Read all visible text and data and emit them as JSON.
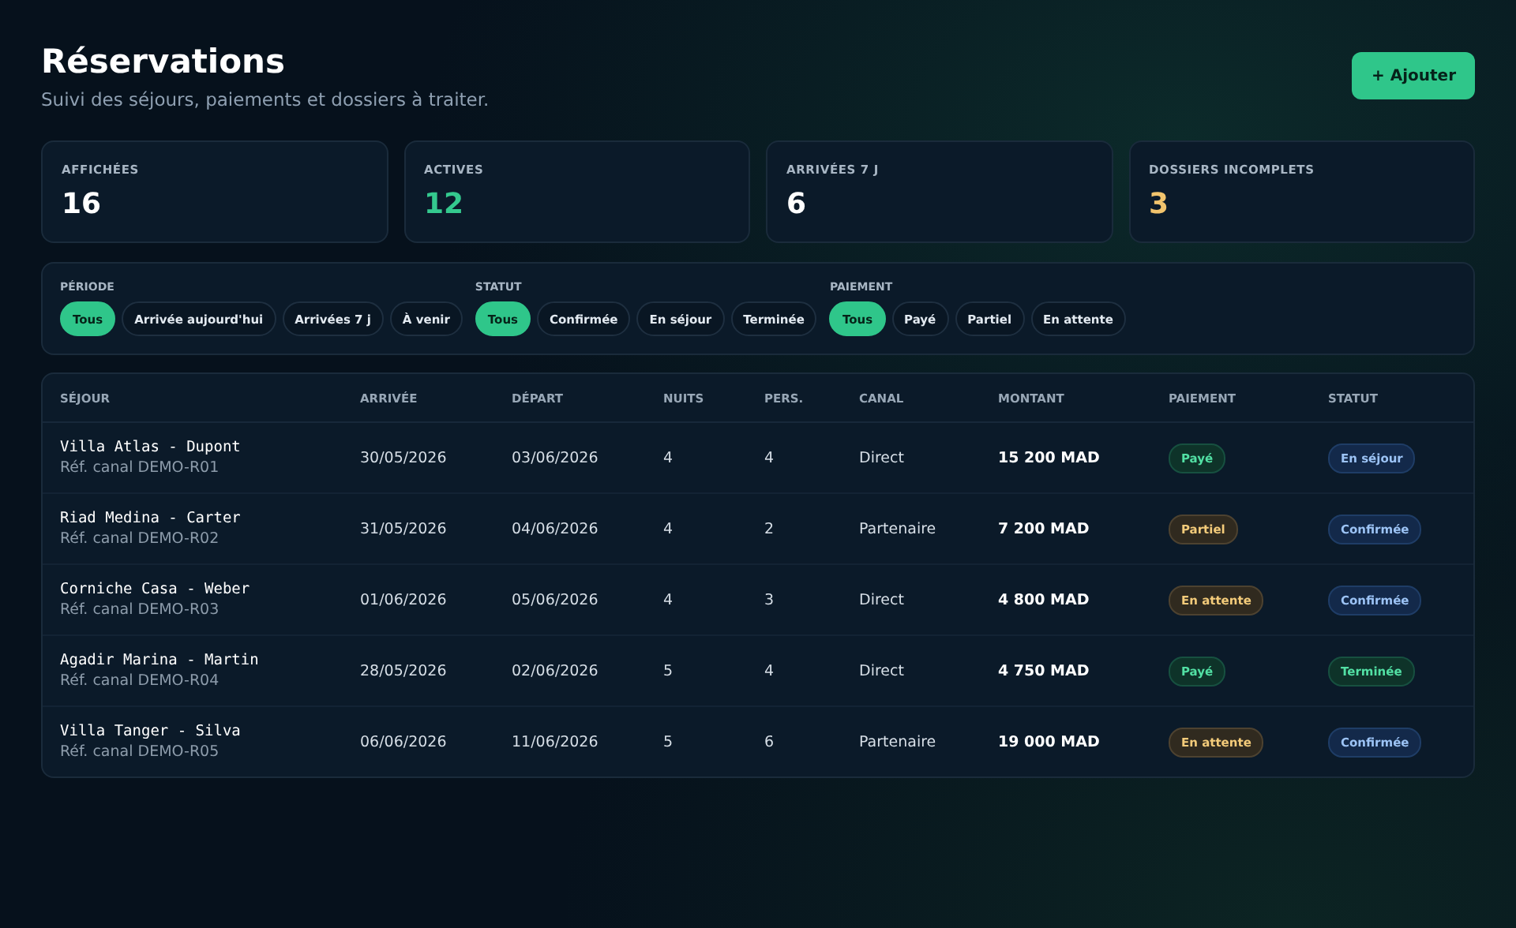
{
  "header": {
    "title": "Réservations",
    "subtitle": "Suivi des séjours, paiements et dossiers à traiter.",
    "add_button": "+ Ajouter"
  },
  "stats": [
    {
      "label": "AFFICHÉES",
      "value": "16",
      "color": "#ffffff"
    },
    {
      "label": "ACTIVES",
      "value": "12",
      "color": "#34c98e"
    },
    {
      "label": "ARRIVÉES 7 J",
      "value": "6",
      "color": "#ffffff"
    },
    {
      "label": "DOSSIERS INCOMPLETS",
      "value": "3",
      "color": "#f2c46d"
    }
  ],
  "filters": [
    {
      "label": "PÉRIODE",
      "options": [
        {
          "label": "Tous",
          "selected": true
        },
        {
          "label": "Arrivée aujourd'hui",
          "selected": false
        },
        {
          "label": "Arrivées 7 j",
          "selected": false
        },
        {
          "label": "À venir",
          "selected": false
        }
      ]
    },
    {
      "label": "STATUT",
      "options": [
        {
          "label": "Tous",
          "selected": true
        },
        {
          "label": "Confirmée",
          "selected": false
        },
        {
          "label": "En séjour",
          "selected": false
        },
        {
          "label": "Terminée",
          "selected": false
        }
      ]
    },
    {
      "label": "PAIEMENT",
      "options": [
        {
          "label": "Tous",
          "selected": true
        },
        {
          "label": "Payé",
          "selected": false
        },
        {
          "label": "Partiel",
          "selected": false
        },
        {
          "label": "En attente",
          "selected": false
        }
      ]
    }
  ],
  "table": {
    "columns": [
      "SÉJOUR",
      "ARRIVÉE",
      "DÉPART",
      "NUITS",
      "PERS.",
      "CANAL",
      "MONTANT",
      "PAIEMENT",
      "STATUT"
    ],
    "rows": [
      {
        "name": "Villa Atlas - Dupont",
        "ref": "Réf. canal DEMO-R01",
        "arrival": "30/05/2026",
        "departure": "03/06/2026",
        "nights": "4",
        "persons": "4",
        "channel": "Direct",
        "amount": "15 200 MAD",
        "payment": {
          "label": "Payé",
          "kind": "success"
        },
        "status": {
          "label": "En séjour",
          "kind": "info"
        }
      },
      {
        "name": "Riad Medina - Carter",
        "ref": "Réf. canal DEMO-R02",
        "arrival": "31/05/2026",
        "departure": "04/06/2026",
        "nights": "4",
        "persons": "2",
        "channel": "Partenaire",
        "amount": "7 200 MAD",
        "payment": {
          "label": "Partiel",
          "kind": "warning"
        },
        "status": {
          "label": "Confirmée",
          "kind": "info"
        }
      },
      {
        "name": "Corniche Casa - Weber",
        "ref": "Réf. canal DEMO-R03",
        "arrival": "01/06/2026",
        "departure": "05/06/2026",
        "nights": "4",
        "persons": "3",
        "channel": "Direct",
        "amount": "4 800 MAD",
        "payment": {
          "label": "En attente",
          "kind": "warning"
        },
        "status": {
          "label": "Confirmée",
          "kind": "info"
        }
      },
      {
        "name": "Agadir Marina - Martin",
        "ref": "Réf. canal DEMO-R04",
        "arrival": "28/05/2026",
        "departure": "02/06/2026",
        "nights": "5",
        "persons": "4",
        "channel": "Direct",
        "amount": "4 750 MAD",
        "payment": {
          "label": "Payé",
          "kind": "success"
        },
        "status": {
          "label": "Terminée",
          "kind": "success"
        }
      },
      {
        "name": "Villa Tanger - Silva",
        "ref": "Réf. canal DEMO-R05",
        "arrival": "06/06/2026",
        "departure": "11/06/2026",
        "nights": "5",
        "persons": "6",
        "channel": "Partenaire",
        "amount": "19 000 MAD",
        "payment": {
          "label": "En attente",
          "kind": "warning"
        },
        "status": {
          "label": "Confirmée",
          "kind": "info"
        }
      }
    ]
  }
}
